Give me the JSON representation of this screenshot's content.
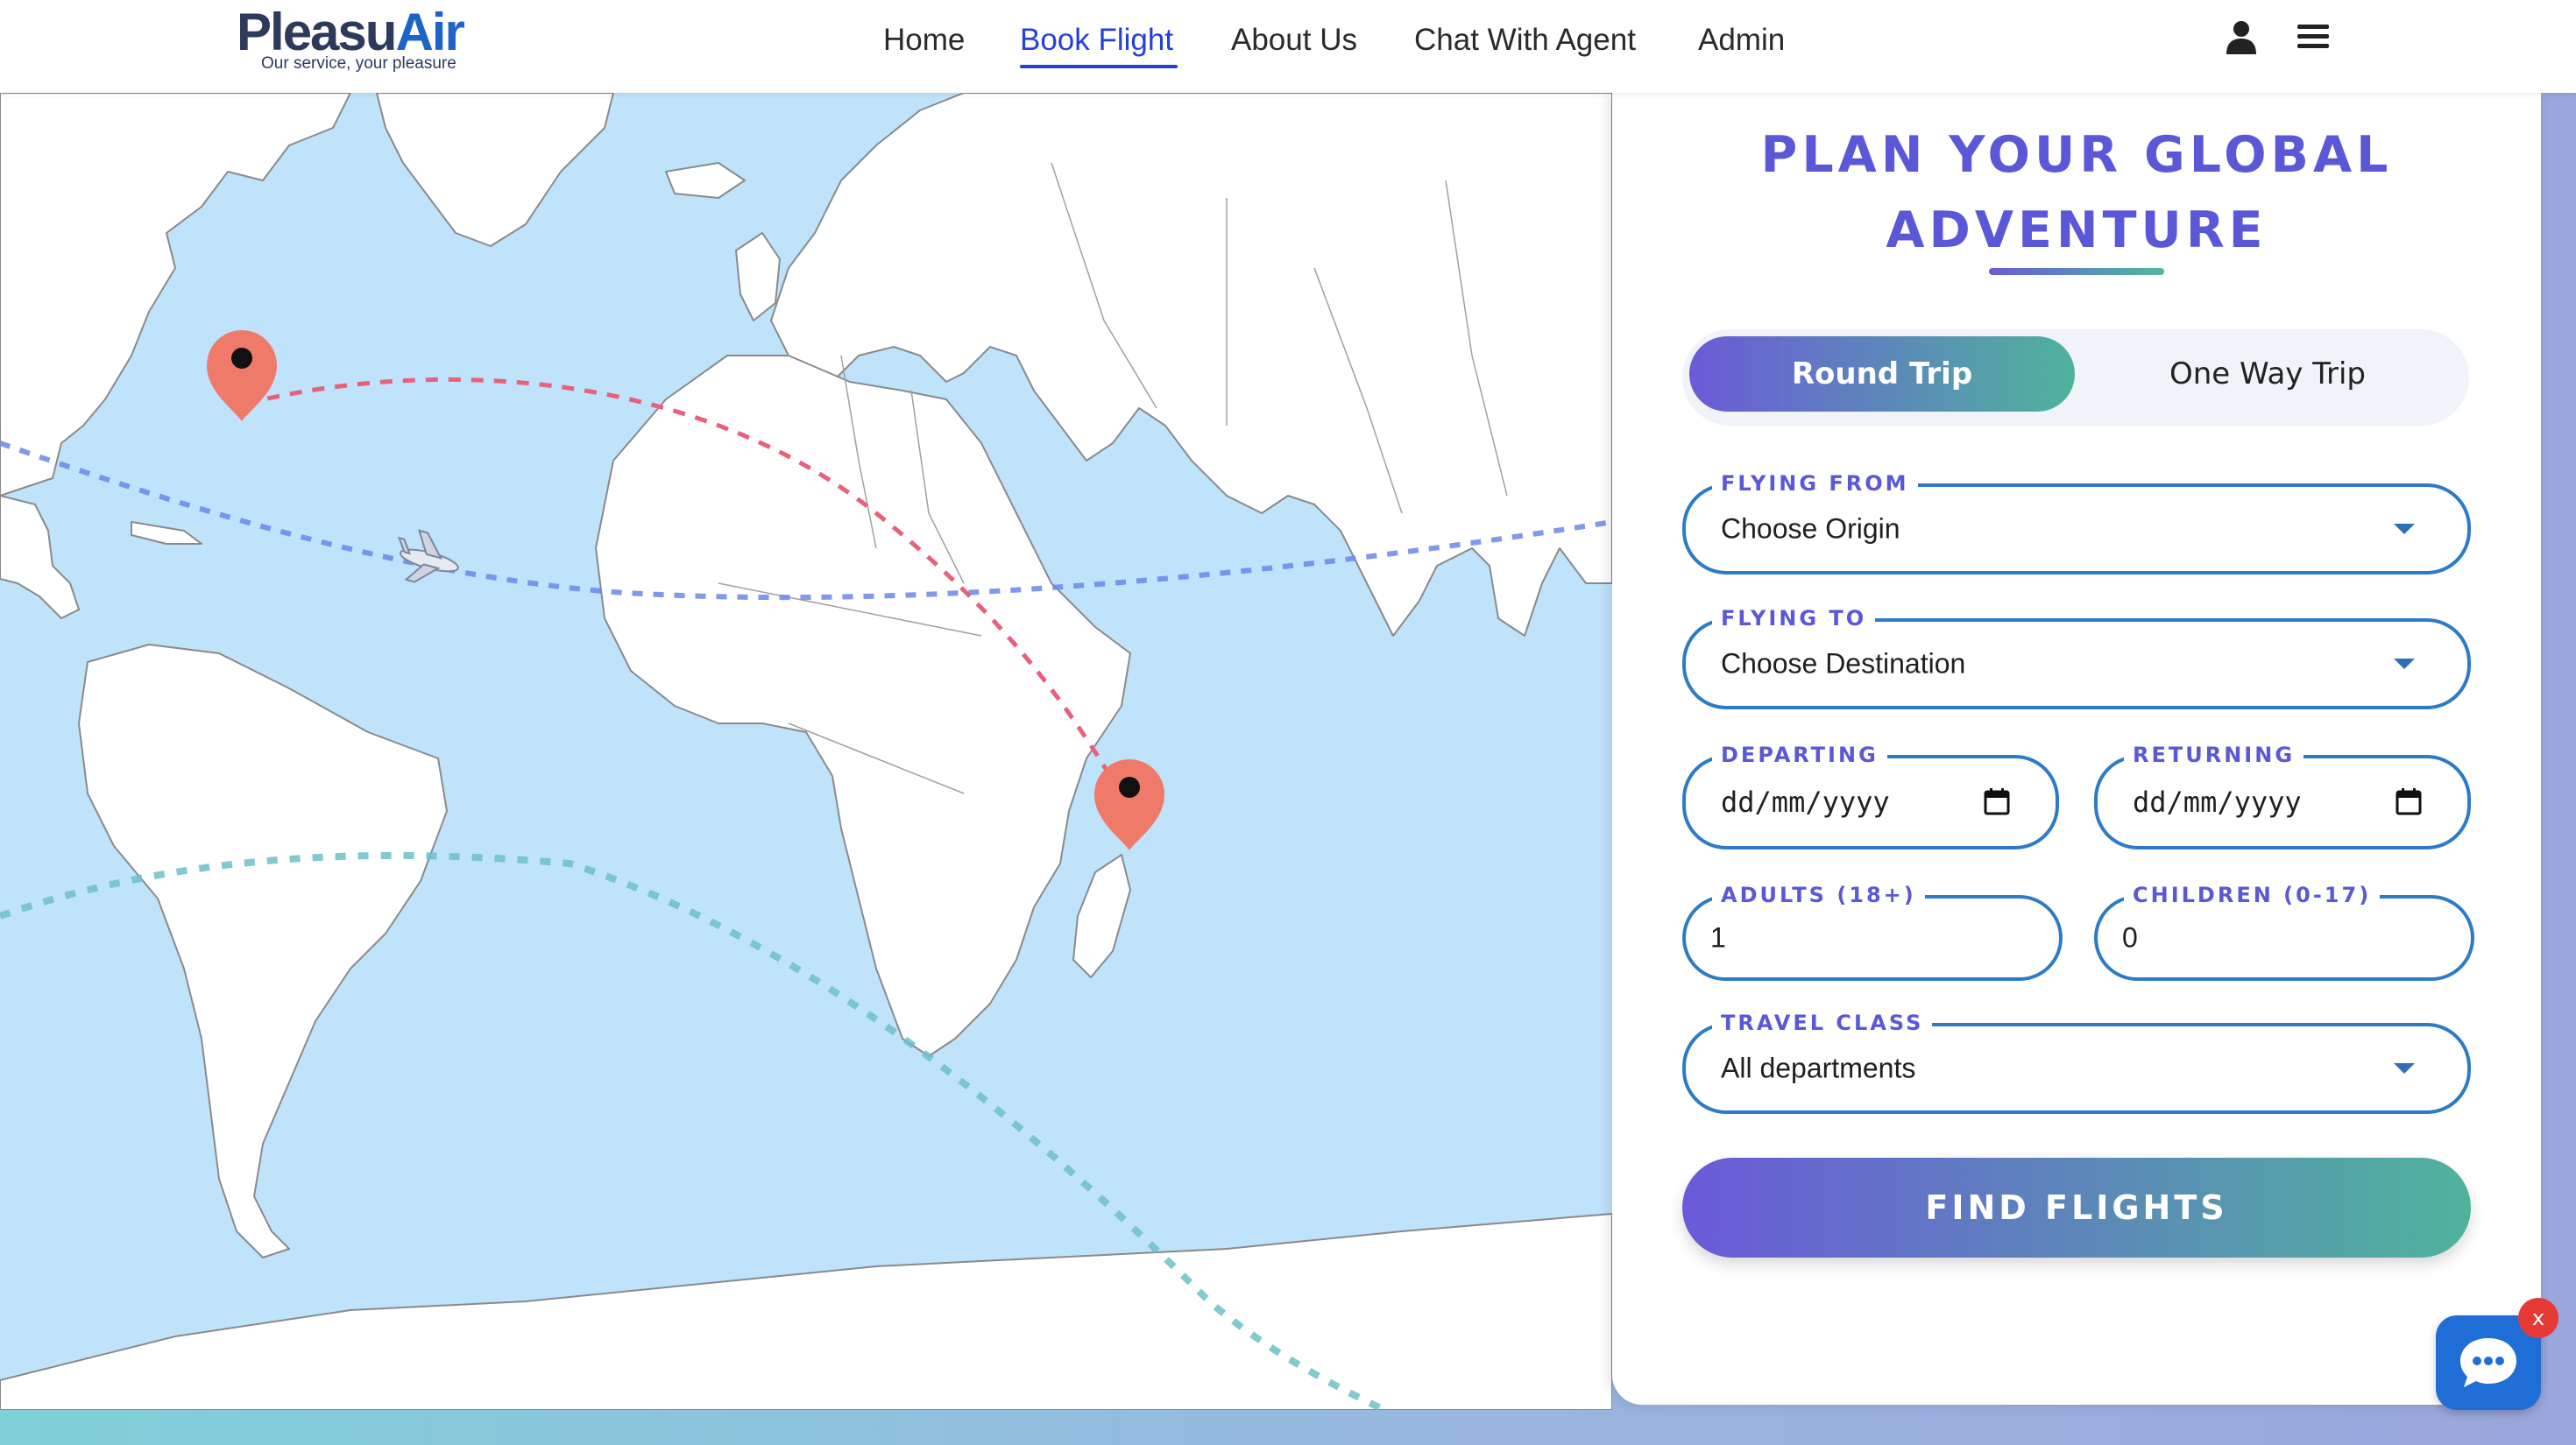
{
  "brand": {
    "name_part1": "Pleasu",
    "name_part2": "Air",
    "tagline": "Our service, your pleasure"
  },
  "nav": {
    "items": [
      {
        "label": "Home",
        "active": false
      },
      {
        "label": "Book Flight",
        "active": true
      },
      {
        "label": "About Us",
        "active": false
      },
      {
        "label": "Chat With Agent",
        "active": false
      },
      {
        "label": "Admin",
        "active": false
      }
    ],
    "active_color": "#2540d9",
    "icons": [
      "user-icon",
      "menu-icon"
    ]
  },
  "map": {
    "markers": [
      "origin-pin-east-us",
      "destination-pin-madagascar"
    ],
    "route_colors": [
      "#e8607a",
      "#6b86e8",
      "#6cc0c8"
    ],
    "ocean_color": "#bfe3fb",
    "land_color": "#ffffff"
  },
  "form": {
    "title_line1": "PLAN YOUR GLOBAL",
    "title_line2": "ADVENTURE",
    "trip": {
      "round": "Round Trip",
      "one_way": "One Way Trip",
      "selected": "Round Trip"
    },
    "flying_from": {
      "label": "FLYING FROM",
      "value": "Choose Origin"
    },
    "flying_to": {
      "label": "FLYING TO",
      "value": "Choose Destination"
    },
    "departing": {
      "label": "DEPARTING",
      "placeholder": "dd/mm/yyyy"
    },
    "returning": {
      "label": "RETURNING",
      "placeholder": "dd/mm/yyyy"
    },
    "adults": {
      "label": "ADULTS (18+)",
      "value": "1"
    },
    "children": {
      "label": "CHILDREN (0-17)",
      "value": "0"
    },
    "travel_class": {
      "label": "TRAVEL CLASS",
      "value": "All departments"
    },
    "submit": "FIND FLIGHTS",
    "accent_color": "#5b58d8",
    "border_color": "#2d7bc6"
  },
  "chat": {
    "close_label": "x",
    "icon": "chat-bubble-icon"
  }
}
